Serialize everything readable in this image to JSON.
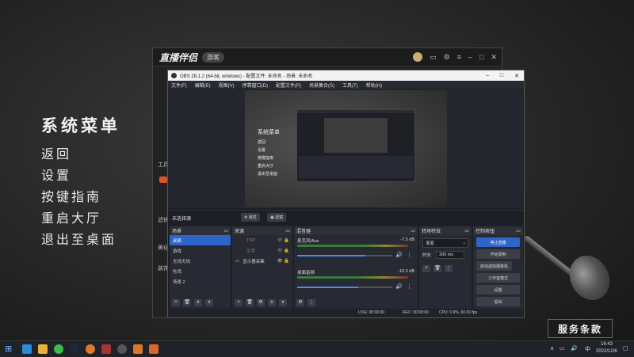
{
  "game_menu": {
    "title": "系统菜单",
    "items": [
      "返回",
      "设置",
      "按键指南",
      "重启大厅",
      "退出至桌面"
    ]
  },
  "launcher": {
    "logo": "直播伴侣",
    "badge": "游客",
    "side_texts": [
      "工具",
      "滤镜",
      "美化",
      "装饰"
    ]
  },
  "obs": {
    "title": "OBS 28.1.2 (64-bit, windows) - 配置文件: 未命名 - 场景: 未命名",
    "menu": [
      "文件(F)",
      "编辑(E)",
      "视图(V)",
      "停靠窗口(D)",
      "配置文件(P)",
      "场景集合(S)",
      "工具(T)",
      "帮助(H)"
    ],
    "preview_menu": {
      "title": "系统菜单",
      "items": [
        "返回",
        "设置",
        "按键指南",
        "重启大厅",
        "退出至桌面"
      ]
    },
    "toolbar": {
      "no_source": "未选择源",
      "properties": "属性",
      "filters": "滤镜"
    },
    "scenes": {
      "header": "场景",
      "items": [
        "桌面",
        "游戏",
        "无线无线",
        "吃鸡",
        "场景 2"
      ],
      "selected_index": 0
    },
    "sources": {
      "header": "来源",
      "items": [
        "TOP",
        "文字",
        "显示器采集"
      ]
    },
    "mixer": {
      "header": "混音器",
      "channels": [
        {
          "name": "麦克风/Aux",
          "db": "-7.5 dB",
          "level": 0.62
        },
        {
          "name": "桌面音频",
          "db": "-10.3 dB",
          "level": 0.55
        }
      ]
    },
    "transitions": {
      "header": "转场特效",
      "type": "渐变",
      "duration_label": "时长",
      "duration_value": "300 ms"
    },
    "controls": {
      "header": "控制按钮",
      "buttons": [
        "停止直播",
        "开始录制",
        "启动虚拟摄像机",
        "工作室模式",
        "设置",
        "退出"
      ]
    },
    "status": {
      "live": "LIVE: 00:00:00",
      "rec": "REC: 00:00:00",
      "cpu": "CPU: 0.9%, 60.00 fps"
    }
  },
  "service_button": "服务条款",
  "taskbar": {
    "time": "16:43",
    "date": "2022/12/6",
    "ime": "中"
  },
  "colors": {
    "accent": "#2f64c8",
    "bg": "#262626"
  }
}
